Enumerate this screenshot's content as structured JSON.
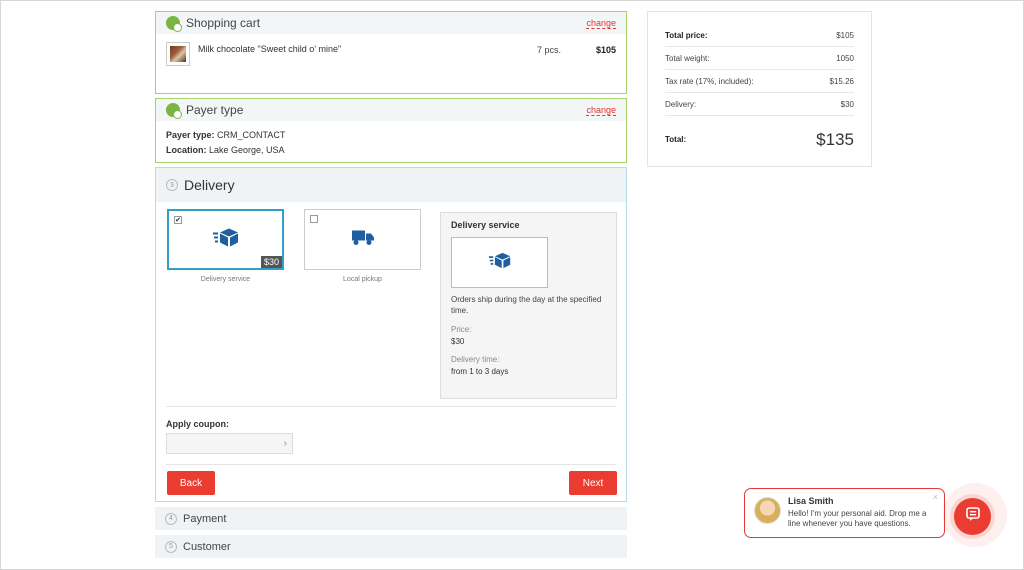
{
  "cart": {
    "title": "Shopping cart",
    "change": "change",
    "item": {
      "name": "Milk chocolate \"Sweet child o' mine\"",
      "qty": "7 pcs.",
      "total": "$105"
    }
  },
  "payer": {
    "title": "Payer type",
    "change": "change",
    "type_label": "Payer type:",
    "type_value": "CRM_CONTACT",
    "location_label": "Location:",
    "location_value": "Lake George, USA"
  },
  "delivery": {
    "step": "3",
    "title": "Delivery",
    "options": [
      {
        "label": "Delivery service",
        "price": "$30",
        "selected": true,
        "checkmark": "✔"
      },
      {
        "label": "Local pickup",
        "selected": false
      }
    ],
    "info": {
      "title": "Delivery service",
      "description": "Orders ship during the day at the specified time.",
      "price_label": "Price:",
      "price_value": "$30",
      "time_label": "Delivery time:",
      "time_value": "from 1 to 3 days"
    },
    "coupon_label": "Apply coupon:",
    "coupon_arrow": "›",
    "back": "Back",
    "next": "Next"
  },
  "payment": {
    "step": "4",
    "title": "Payment"
  },
  "customer": {
    "step": "5",
    "title": "Customer"
  },
  "summary": {
    "rows": [
      {
        "label": "Total price:",
        "value": "$105"
      },
      {
        "label": "Total weight:",
        "value": "1050"
      },
      {
        "label": "Tax rate (17%, included):",
        "value": "$15.26"
      },
      {
        "label": "Delivery:",
        "value": "$30"
      }
    ],
    "total_label": "Total:",
    "total_value": "$135"
  },
  "chat": {
    "name": "Lisa Smith",
    "message": "Hello! I'm your personal aid. Drop me a line whenever you have questions.",
    "close": "×"
  },
  "colors": {
    "accent": "#ea3c31",
    "done": "#7ab544",
    "delivery_icon": "#1f5fa0",
    "selected_border": "#2fa1c8"
  }
}
